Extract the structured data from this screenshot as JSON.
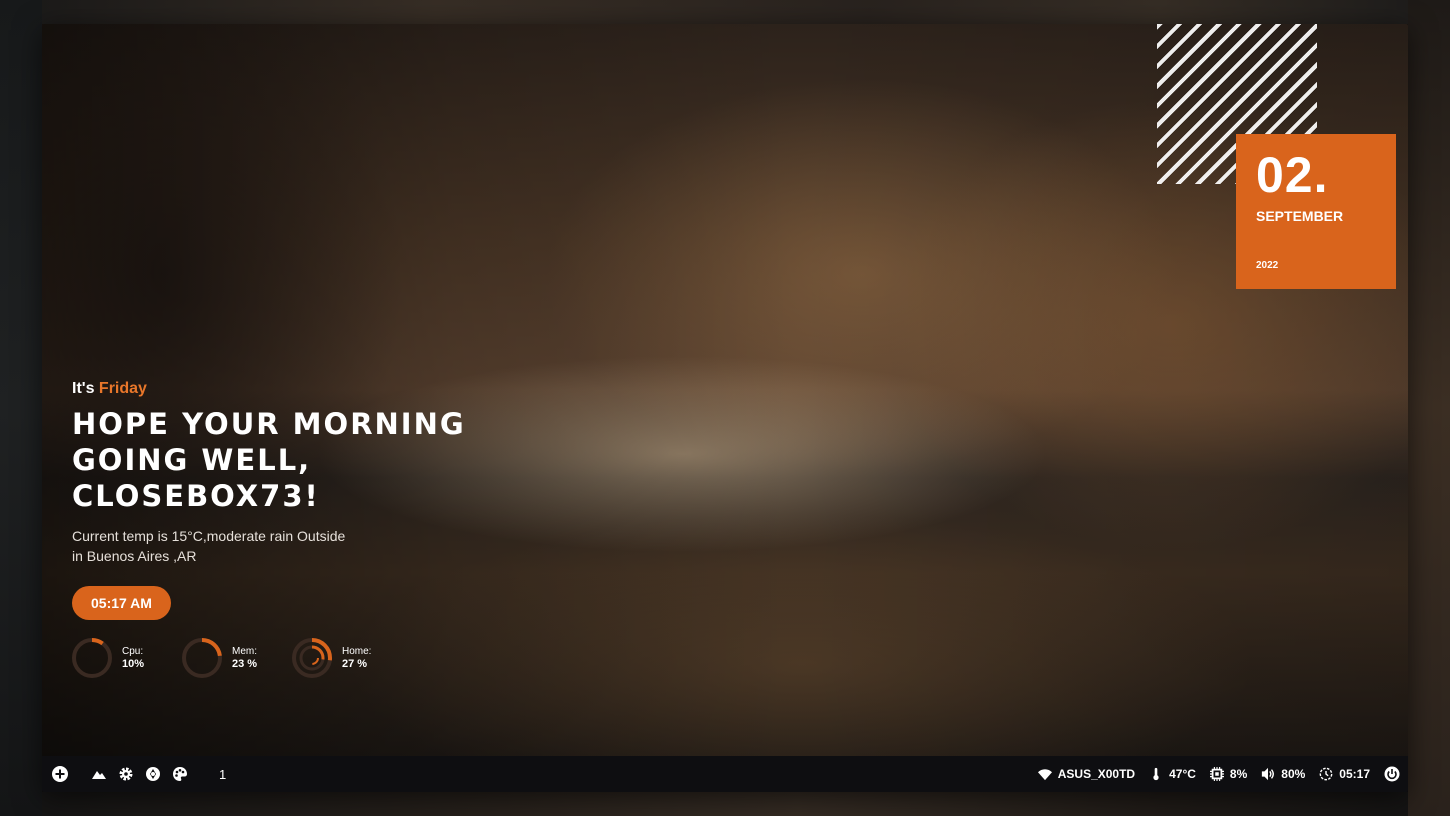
{
  "date": {
    "day": "02.",
    "month": "SEPTEMBER",
    "year": "2022"
  },
  "greeting": {
    "prefix": "It's ",
    "day": "Friday",
    "headline": "Hope your morning going well, closebox73!",
    "weather_line1": "Current temp is 15°C,moderate rain Outside",
    "weather_line2": "in Buenos Aires ,AR",
    "time": "05:17 AM"
  },
  "stats": [
    {
      "label": "Cpu:",
      "value": "10%",
      "percent": 10
    },
    {
      "label": "Mem:",
      "value": "23 %",
      "percent": 23
    },
    {
      "label": "Home:",
      "value": "27 %",
      "percent": 27
    }
  ],
  "panel": {
    "workspace": "1",
    "wifi": "ASUS_X00TD",
    "temp": "47°C",
    "cpu": "8%",
    "volume": "80%",
    "clock": "05:17"
  },
  "colors": {
    "accent": "#d9641c",
    "panel_bg": "#0e0e11"
  }
}
